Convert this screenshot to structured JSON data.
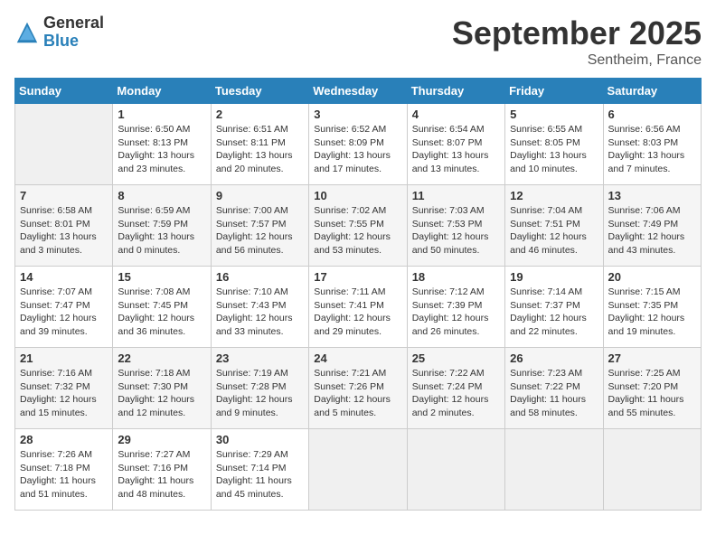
{
  "logo": {
    "general": "General",
    "blue": "Blue"
  },
  "title": "September 2025",
  "subtitle": "Sentheim, France",
  "headers": [
    "Sunday",
    "Monday",
    "Tuesday",
    "Wednesday",
    "Thursday",
    "Friday",
    "Saturday"
  ],
  "weeks": [
    [
      {
        "day": "",
        "info": ""
      },
      {
        "day": "1",
        "info": "Sunrise: 6:50 AM\nSunset: 8:13 PM\nDaylight: 13 hours\nand 23 minutes."
      },
      {
        "day": "2",
        "info": "Sunrise: 6:51 AM\nSunset: 8:11 PM\nDaylight: 13 hours\nand 20 minutes."
      },
      {
        "day": "3",
        "info": "Sunrise: 6:52 AM\nSunset: 8:09 PM\nDaylight: 13 hours\nand 17 minutes."
      },
      {
        "day": "4",
        "info": "Sunrise: 6:54 AM\nSunset: 8:07 PM\nDaylight: 13 hours\nand 13 minutes."
      },
      {
        "day": "5",
        "info": "Sunrise: 6:55 AM\nSunset: 8:05 PM\nDaylight: 13 hours\nand 10 minutes."
      },
      {
        "day": "6",
        "info": "Sunrise: 6:56 AM\nSunset: 8:03 PM\nDaylight: 13 hours\nand 7 minutes."
      }
    ],
    [
      {
        "day": "7",
        "info": "Sunrise: 6:58 AM\nSunset: 8:01 PM\nDaylight: 13 hours\nand 3 minutes."
      },
      {
        "day": "8",
        "info": "Sunrise: 6:59 AM\nSunset: 7:59 PM\nDaylight: 13 hours\nand 0 minutes."
      },
      {
        "day": "9",
        "info": "Sunrise: 7:00 AM\nSunset: 7:57 PM\nDaylight: 12 hours\nand 56 minutes."
      },
      {
        "day": "10",
        "info": "Sunrise: 7:02 AM\nSunset: 7:55 PM\nDaylight: 12 hours\nand 53 minutes."
      },
      {
        "day": "11",
        "info": "Sunrise: 7:03 AM\nSunset: 7:53 PM\nDaylight: 12 hours\nand 50 minutes."
      },
      {
        "day": "12",
        "info": "Sunrise: 7:04 AM\nSunset: 7:51 PM\nDaylight: 12 hours\nand 46 minutes."
      },
      {
        "day": "13",
        "info": "Sunrise: 7:06 AM\nSunset: 7:49 PM\nDaylight: 12 hours\nand 43 minutes."
      }
    ],
    [
      {
        "day": "14",
        "info": "Sunrise: 7:07 AM\nSunset: 7:47 PM\nDaylight: 12 hours\nand 39 minutes."
      },
      {
        "day": "15",
        "info": "Sunrise: 7:08 AM\nSunset: 7:45 PM\nDaylight: 12 hours\nand 36 minutes."
      },
      {
        "day": "16",
        "info": "Sunrise: 7:10 AM\nSunset: 7:43 PM\nDaylight: 12 hours\nand 33 minutes."
      },
      {
        "day": "17",
        "info": "Sunrise: 7:11 AM\nSunset: 7:41 PM\nDaylight: 12 hours\nand 29 minutes."
      },
      {
        "day": "18",
        "info": "Sunrise: 7:12 AM\nSunset: 7:39 PM\nDaylight: 12 hours\nand 26 minutes."
      },
      {
        "day": "19",
        "info": "Sunrise: 7:14 AM\nSunset: 7:37 PM\nDaylight: 12 hours\nand 22 minutes."
      },
      {
        "day": "20",
        "info": "Sunrise: 7:15 AM\nSunset: 7:35 PM\nDaylight: 12 hours\nand 19 minutes."
      }
    ],
    [
      {
        "day": "21",
        "info": "Sunrise: 7:16 AM\nSunset: 7:32 PM\nDaylight: 12 hours\nand 15 minutes."
      },
      {
        "day": "22",
        "info": "Sunrise: 7:18 AM\nSunset: 7:30 PM\nDaylight: 12 hours\nand 12 minutes."
      },
      {
        "day": "23",
        "info": "Sunrise: 7:19 AM\nSunset: 7:28 PM\nDaylight: 12 hours\nand 9 minutes."
      },
      {
        "day": "24",
        "info": "Sunrise: 7:21 AM\nSunset: 7:26 PM\nDaylight: 12 hours\nand 5 minutes."
      },
      {
        "day": "25",
        "info": "Sunrise: 7:22 AM\nSunset: 7:24 PM\nDaylight: 12 hours\nand 2 minutes."
      },
      {
        "day": "26",
        "info": "Sunrise: 7:23 AM\nSunset: 7:22 PM\nDaylight: 11 hours\nand 58 minutes."
      },
      {
        "day": "27",
        "info": "Sunrise: 7:25 AM\nSunset: 7:20 PM\nDaylight: 11 hours\nand 55 minutes."
      }
    ],
    [
      {
        "day": "28",
        "info": "Sunrise: 7:26 AM\nSunset: 7:18 PM\nDaylight: 11 hours\nand 51 minutes."
      },
      {
        "day": "29",
        "info": "Sunrise: 7:27 AM\nSunset: 7:16 PM\nDaylight: 11 hours\nand 48 minutes."
      },
      {
        "day": "30",
        "info": "Sunrise: 7:29 AM\nSunset: 7:14 PM\nDaylight: 11 hours\nand 45 minutes."
      },
      {
        "day": "",
        "info": ""
      },
      {
        "day": "",
        "info": ""
      },
      {
        "day": "",
        "info": ""
      },
      {
        "day": "",
        "info": ""
      }
    ]
  ]
}
